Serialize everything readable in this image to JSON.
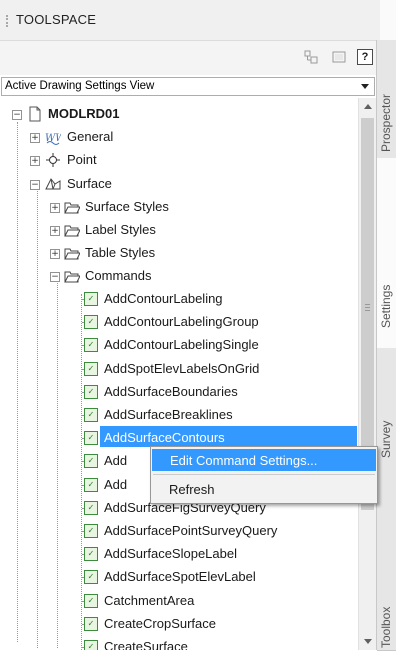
{
  "window": {
    "title": "TOOLSPACE"
  },
  "toolbar": {
    "help_label": "?"
  },
  "view_selector": {
    "selected": "Active Drawing Settings View"
  },
  "tree": {
    "root": {
      "label": "MODLRD01"
    },
    "general": {
      "label": "General"
    },
    "point": {
      "label": "Point"
    },
    "surface": {
      "label": "Surface"
    },
    "surface_styles": {
      "label": "Surface Styles"
    },
    "label_styles": {
      "label": "Label Styles"
    },
    "table_styles": {
      "label": "Table Styles"
    },
    "commands": {
      "label": "Commands"
    },
    "command_items": [
      "AddContourLabeling",
      "AddContourLabelingGroup",
      "AddContourLabelingSingle",
      "AddSpotElevLabelsOnGrid",
      "AddSurfaceBoundaries",
      "AddSurfaceBreaklines",
      "AddSurfaceContours",
      "Add",
      "Add",
      "AddSurfaceFigSurveyQuery",
      "AddSurfacePointSurveyQuery",
      "AddSurfaceSlopeLabel",
      "AddSurfaceSpotElevLabel",
      "CatchmentArea",
      "CreateCropSurface",
      "CreateSurface"
    ]
  },
  "side_tabs": [
    "Prospector",
    "Settings",
    "Survey",
    "Toolbox"
  ],
  "context_menu": {
    "items": [
      "Edit Command Settings...",
      "Refresh"
    ]
  },
  "colors": {
    "selection": "#3399ff",
    "command_icon": "#3d8c3d"
  }
}
